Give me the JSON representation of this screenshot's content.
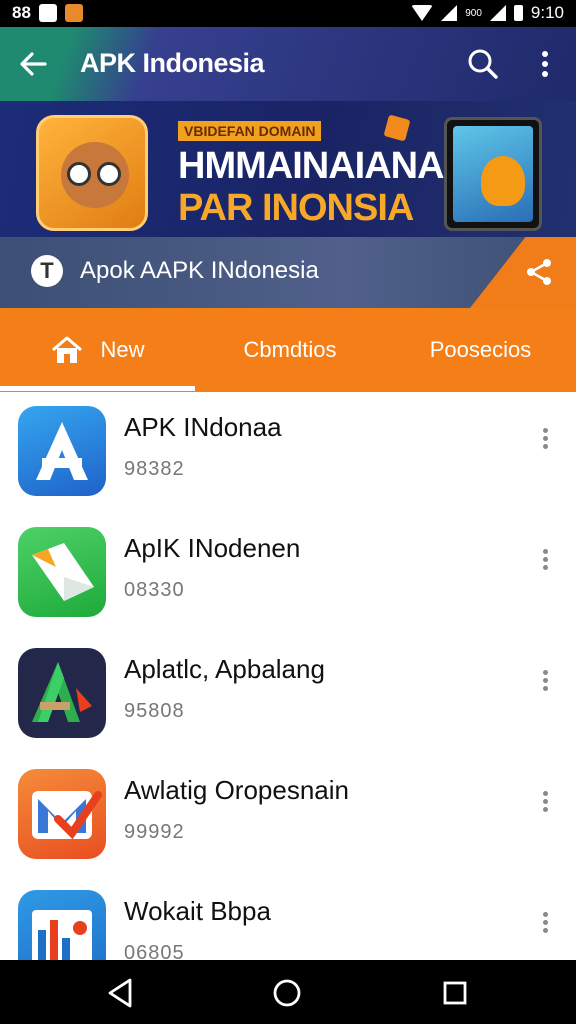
{
  "status_bar": {
    "left_text": "88",
    "network_label": "900",
    "time": "9:10"
  },
  "app_bar": {
    "title": "APK Indonesia"
  },
  "banner": {
    "tag": "VBIDEFAN DOMAIN",
    "headline_line1": "HMMAINAIANA",
    "headline_line2": "PAR INONSIA"
  },
  "strip": {
    "logo_glyph": "T",
    "text": "Apok AAPK INdonesia"
  },
  "tabs": [
    {
      "label": "New",
      "selected": true
    },
    {
      "label": "Cbmdtios",
      "selected": false
    },
    {
      "label": "Poosecios",
      "selected": false
    }
  ],
  "apps": [
    {
      "name": "APK INdonaa",
      "sub": "98382",
      "icon": "letter-a-icon"
    },
    {
      "name": "ApIK INodenen",
      "sub": "08330",
      "icon": "document-icon"
    },
    {
      "name": "Aplatlc, Apbalang",
      "sub": "95808",
      "icon": "green-a-icon"
    },
    {
      "name": "Awlatig Oropesnain",
      "sub": "99992",
      "icon": "m-check-icon"
    },
    {
      "name": "Wokait Bbpa",
      "sub": "06805",
      "icon": "chart-icon"
    }
  ],
  "colors": {
    "accent": "#f47e17",
    "app_bar": "#1f2a6b",
    "status_bar": "#000000"
  }
}
